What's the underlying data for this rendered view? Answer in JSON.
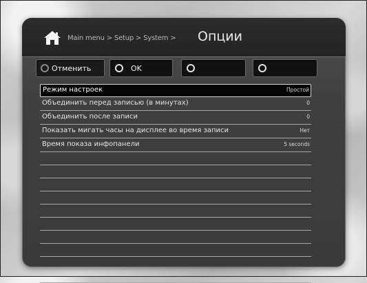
{
  "header": {
    "breadcrumb": "Main menu > Setup > System >",
    "title": "Опции",
    "icon": "home-icon"
  },
  "buttons": [
    {
      "label": "Отменить"
    },
    {
      "label": "OK"
    },
    {
      "label": ""
    },
    {
      "label": ""
    }
  ],
  "settings": [
    {
      "name": "Режим настроек",
      "value": "Простой"
    },
    {
      "name": "Объединить перед записью (в минутах)",
      "value": "0"
    },
    {
      "name": "Объединить после записи",
      "value": "0"
    },
    {
      "name": "Показать мигать часы на дисплее во время записи",
      "value": "Нет"
    },
    {
      "name": "Время показа инфопанели",
      "value": "5 seconds"
    }
  ],
  "colors": {
    "panel": "#3f3f3f",
    "header": "#262626",
    "button": "#111111",
    "selected_row": "#050505",
    "text": "#e6e6e6"
  }
}
